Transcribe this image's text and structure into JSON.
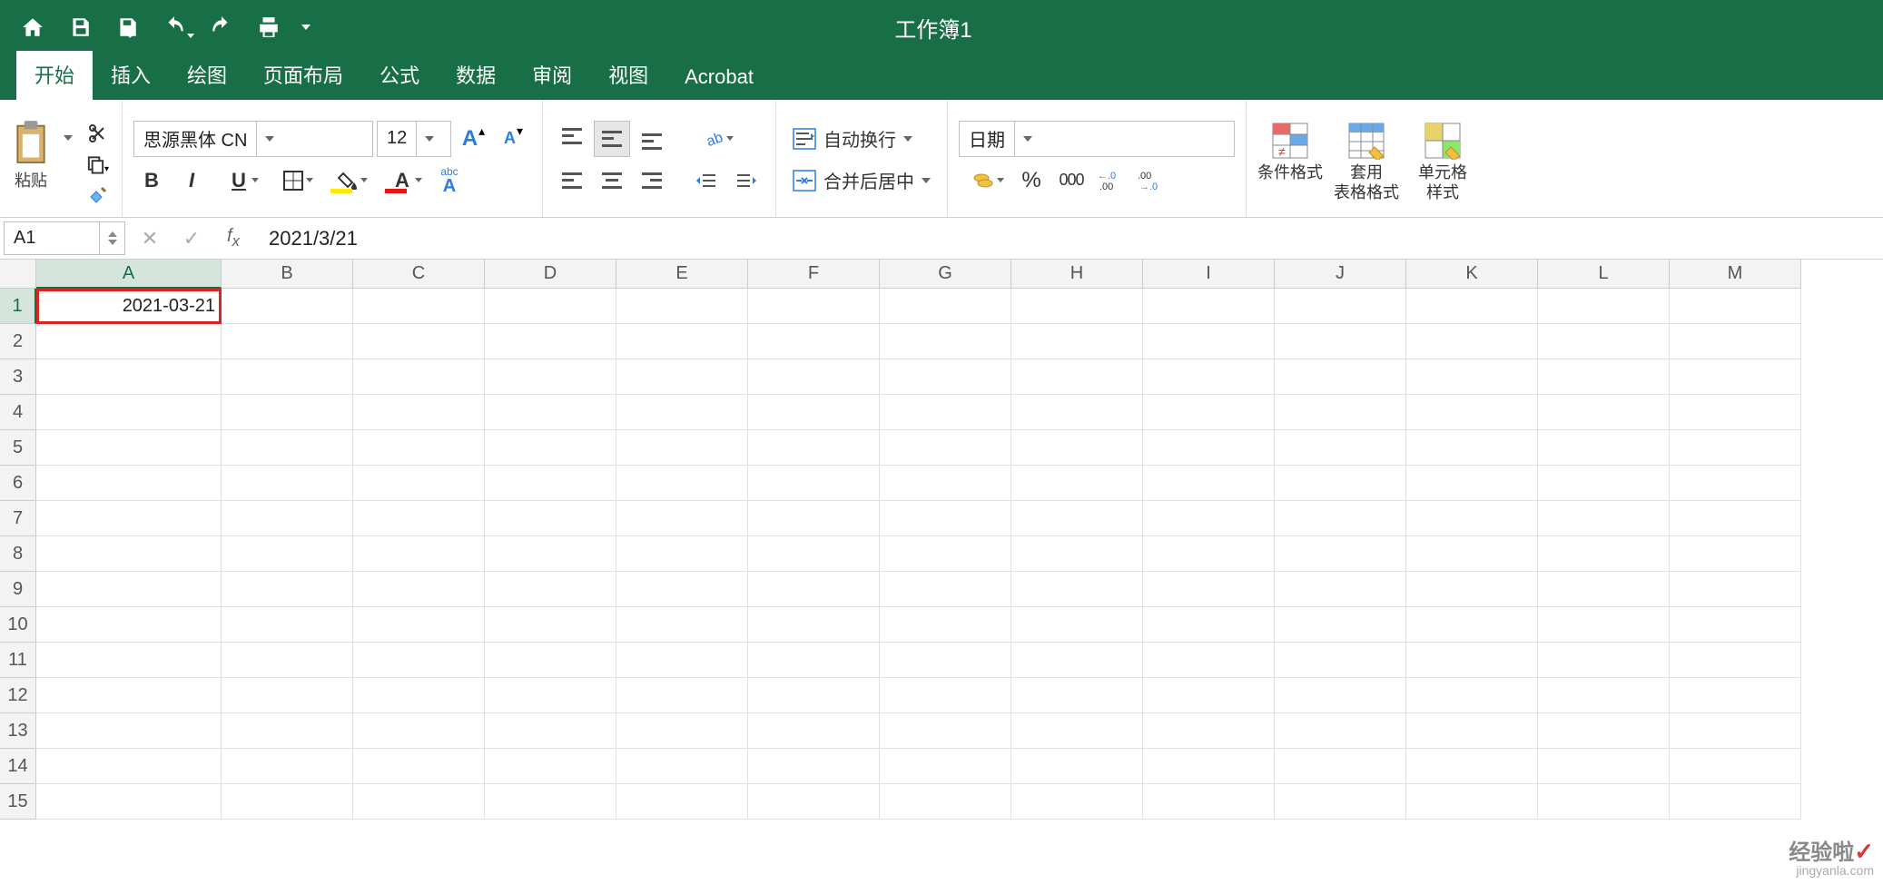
{
  "title": "工作簿1",
  "tabs": [
    "开始",
    "插入",
    "绘图",
    "页面布局",
    "公式",
    "数据",
    "审阅",
    "视图",
    "Acrobat"
  ],
  "activeTab": 0,
  "clipboard": {
    "paste": "粘贴"
  },
  "font": {
    "name": "思源黑体 CN",
    "size": "12",
    "bold": "B",
    "italic": "I",
    "underline": "U"
  },
  "wrap": {
    "autowrap": "自动换行",
    "merge": "合并后居中"
  },
  "number": {
    "format": "日期"
  },
  "styles": {
    "cond": "条件格式",
    "table": "套用\n表格格式",
    "cell": "单元格\n样式"
  },
  "namebox": "A1",
  "formula": "2021/3/21",
  "columns": [
    "A",
    "B",
    "C",
    "D",
    "E",
    "F",
    "G",
    "H",
    "I",
    "J",
    "K",
    "L",
    "M"
  ],
  "rows": [
    "1",
    "2",
    "3",
    "4",
    "5",
    "6",
    "7",
    "8",
    "9",
    "10",
    "11",
    "12",
    "13",
    "14",
    "15"
  ],
  "cell_A1": "2021-03-21",
  "watermark": {
    "ch": "经验啦",
    "dom": "jingyanla.com"
  }
}
